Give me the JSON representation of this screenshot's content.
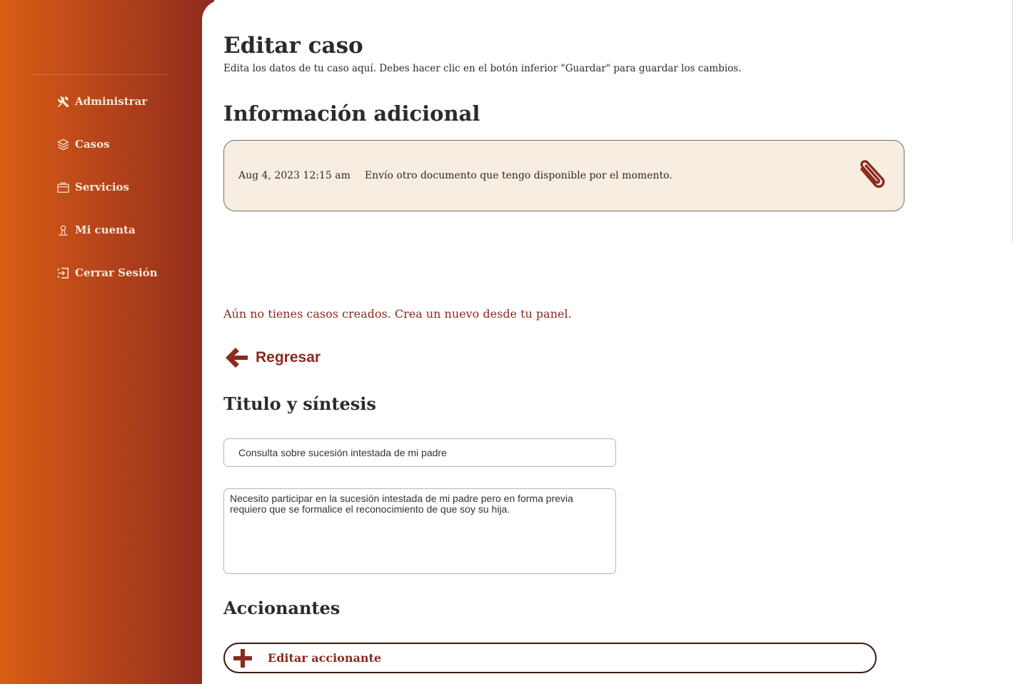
{
  "sidebar": {
    "items": [
      {
        "label": "Administrar",
        "icon": "tools-icon"
      },
      {
        "label": "Casos",
        "icon": "layers-icon"
      },
      {
        "label": "Servicios",
        "icon": "briefcase-icon"
      },
      {
        "label": "Mi cuenta",
        "icon": "user-icon"
      },
      {
        "label": "Cerrar Sesión",
        "icon": "logout-icon"
      }
    ]
  },
  "header": {
    "title": "Editar caso",
    "subtitle": "Edita los datos de tu caso aquí. Debes hacer clic en el botón inferior \"Guardar\" para guardar los cambios."
  },
  "info": {
    "title": "Información adicional",
    "entries": [
      {
        "date": "Aug 4, 2023 12:15 am",
        "text": "Envío otro documento que tengo disponible por el momento."
      }
    ]
  },
  "empty_message": "Aún no tienes casos creados. Crea un nuevo desde tu panel.",
  "back_label": "Regresar",
  "title_section": {
    "heading": "Titulo y síntesis",
    "title_value": "Consulta sobre sucesión intestada de mi padre",
    "summary_value": "Necesito participar en la sucesión intestada de mi padre pero en forma previa requiero que se formalice el reconocimiento de que soy su hija."
  },
  "accionantes": {
    "heading": "Accionantes",
    "edit_label": "Editar accionante"
  },
  "colors": {
    "accent": "#8a2b1d",
    "sidebar_start": "#d95d14",
    "sidebar_end": "#8e2a1c",
    "card_bg": "#f7ede0"
  }
}
